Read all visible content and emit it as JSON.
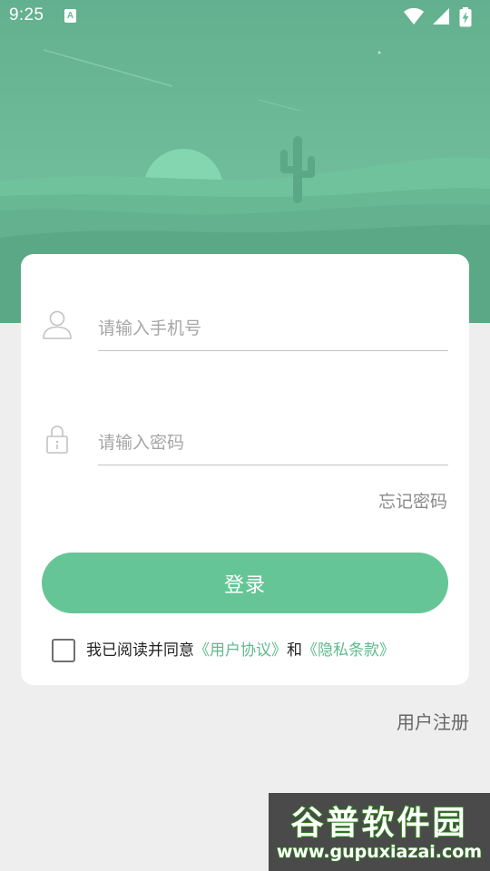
{
  "status_bar": {
    "time": "9:25",
    "notification_icon": "A"
  },
  "login": {
    "phone_placeholder": "请输入手机号",
    "password_placeholder": "请输入密码",
    "forgot_password": "忘记密码",
    "login_button": "登录",
    "agreement": {
      "prefix": "我已阅读并同意",
      "user_agreement": "《用户协议》",
      "connector": "和",
      "privacy_terms": "《隐私条款》",
      "checked": false
    }
  },
  "register_link": "用户注册",
  "watermark": {
    "title": "谷普软件园",
    "url": "www.gupuxiazai.com"
  },
  "icons": {
    "phone_field": "user-icon",
    "password_field": "lock-icon",
    "status": [
      "wifi-icon",
      "cellular-signal-icon",
      "battery-charging-icon"
    ]
  },
  "colors": {
    "brand_green": "#66c596",
    "link_green": "#5eb98e",
    "header_green": "#67b996"
  }
}
